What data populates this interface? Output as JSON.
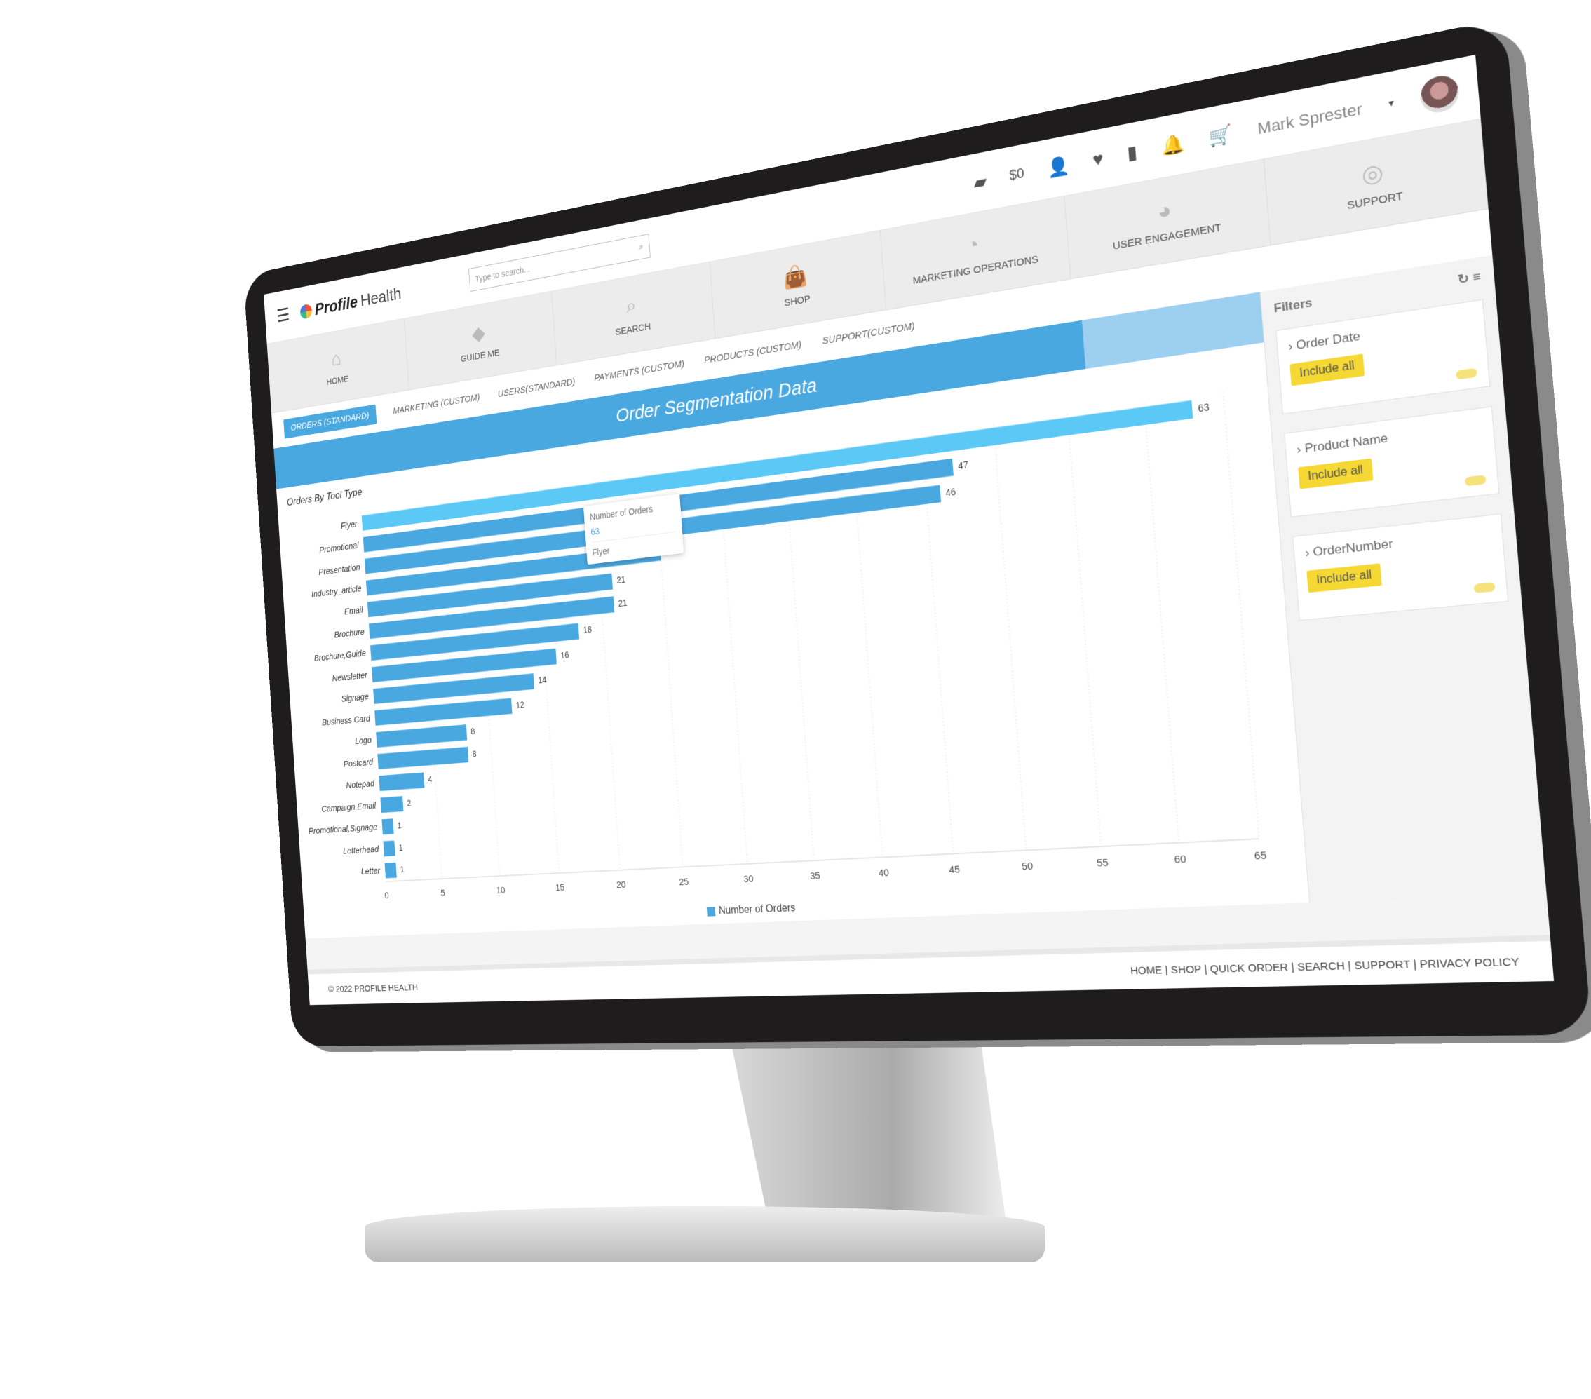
{
  "header": {
    "logo_bold": "Profile",
    "logo_light": "Health",
    "search_placeholder": "Type to search...",
    "balance": "$0",
    "user_name": "Mark Sprester"
  },
  "nav_tiles": [
    {
      "label": "HOME",
      "icon": "home-icon"
    },
    {
      "label": "GUIDE ME",
      "icon": "diamond-icon"
    },
    {
      "label": "SEARCH",
      "icon": "search-icon"
    },
    {
      "label": "SHOP",
      "icon": "bag-icon"
    },
    {
      "label": "MARKETING OPERATIONS",
      "icon": "gauge-icon"
    },
    {
      "label": "USER ENGAGEMENT",
      "icon": "pie-icon"
    },
    {
      "label": "SUPPORT",
      "icon": "lifebuoy-icon"
    }
  ],
  "tabs": [
    "ORDERS (STANDARD)",
    "MARKETING (CUSTOM)",
    "USERS(STANDARD)",
    "PAYMENTS (CUSTOM)",
    "PRODUCTS (CUSTOM)",
    "SUPPORT(CUSTOM)"
  ],
  "banner_title": "Order Segmentation Data",
  "tooltip": {
    "series": "Number of Orders",
    "value": "63",
    "category": "Flyer"
  },
  "filters": {
    "title": "Filters",
    "items": [
      {
        "name": "Order Date",
        "button": "Include all"
      },
      {
        "name": "Product Name",
        "button": "Include all"
      },
      {
        "name": "OrderNumber",
        "button": "Include all"
      }
    ]
  },
  "footer": {
    "copyright": "© 2022 PROFILE HEALTH",
    "links": "HOME | SHOP | QUICK ORDER | SEARCH | SUPPORT | PRIVACY POLICY"
  },
  "colors": {
    "accent": "#4aa8e0",
    "highlight": "#5bc8f5",
    "filter_button": "#f5d833"
  },
  "chart_data": {
    "type": "bar",
    "orientation": "horizontal",
    "title": "Orders By Tool Type",
    "categories": [
      "Flyer",
      "Promotional",
      "Presentation",
      "Industry_article",
      "Email",
      "Brochure",
      "Brochure,Guide",
      "Newsletter",
      "Signage",
      "Business Card",
      "Logo",
      "Postcard",
      "Notepad",
      "Campaign,Email",
      "Promotional,Signage",
      "Letterhead",
      "Letter"
    ],
    "series": [
      {
        "name": "Number of Orders",
        "values": [
          63,
          47,
          46,
          25,
          21,
          21,
          18,
          16,
          14,
          12,
          8,
          8,
          4,
          2,
          1,
          1,
          1
        ]
      }
    ],
    "xlim": [
      0,
      65
    ],
    "xticks": [
      0,
      5,
      10,
      15,
      20,
      25,
      30,
      35,
      40,
      45,
      50,
      55,
      60,
      65
    ],
    "grid": true,
    "legend": "bottom",
    "highlighted": "Flyer"
  }
}
